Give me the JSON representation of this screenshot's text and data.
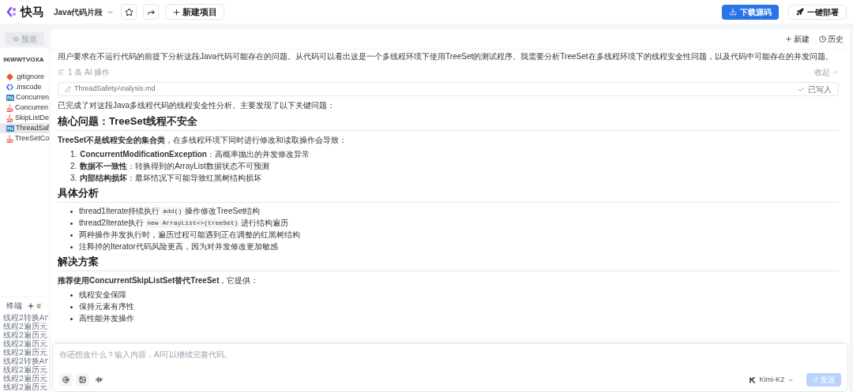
{
  "header": {
    "logo_text": "快马",
    "project_name": "Java代码片段",
    "new_project": "新建项目",
    "download": "下载源码",
    "deploy": "一键部署"
  },
  "sidebar": {
    "preview": {
      "label": "预览",
      "disabled": true
    },
    "project_id": "96WWTVOXA",
    "files": [
      {
        "name": ".gitignore",
        "kind": "git",
        "selected": false
      },
      {
        "name": ".inscode",
        "kind": "inscode",
        "selected": false
      },
      {
        "name": "Concurren",
        "kind": "markdown",
        "selected": false
      },
      {
        "name": "Concurren",
        "kind": "java",
        "selected": false
      },
      {
        "name": "SkipListDe",
        "kind": "java",
        "selected": false
      },
      {
        "name": "ThreadSaf",
        "kind": "markdown",
        "selected": true
      },
      {
        "name": "TreeSetCo",
        "kind": "java",
        "selected": false
      }
    ],
    "terminal": {
      "title": "终端",
      "lines": [
        "线程2转换Ar",
        "线程2遍历元",
        "线程2遍历元",
        "线程2遍历元",
        "线程2遍历元",
        "线程2转换Ar",
        "线程2遍历元",
        "线程2遍历元",
        "线程2遍历元"
      ]
    }
  },
  "toolbar": {
    "new": "新建",
    "history": "历史"
  },
  "blocks": [
    {
      "kind": "paragraph",
      "text": "用户要求在不运行代码的前提下分析这段Java代码可能存在的问题。从代码可以看出这是一个多线程环境下使用TreeSet的测试程序。我需要分析TreeSet在多线程环境下的线程安全性问题，以及代码中可能存在的并发问题。",
      "muted": false
    },
    {
      "kind": "ai_ops",
      "text": "1 条 AI 操作",
      "toggle": "收起",
      "expanded": true
    },
    {
      "kind": "file_card",
      "file": "ThreadSafetyAnalysis.md",
      "status": "已写入",
      "written": true
    },
    {
      "kind": "paragraph",
      "text": "已完成了对这段Java多线程代码的线程安全性分析。主要发现了以下关键问题：",
      "muted": false
    },
    {
      "kind": "heading",
      "text": "核心问题：TreeSet线程不安全"
    },
    {
      "kind": "paragraph",
      "text": "**TreeSet不是线程安全的集合类**，在多线程环境下同时进行修改和读取操作会导致：",
      "muted": false
    },
    {
      "kind": "ordered_list",
      "items": [
        {
          "number": "1.",
          "text": "**ConcurrentModificationException**：高概率抛出的并发修改异常"
        },
        {
          "number": "2.",
          "text": "**数据不一致性**：转换得到的ArrayList数据状态不可预测"
        },
        {
          "number": "3.",
          "text": "**内部结构损坏**：最坏情况下可能导致红黑树结构损坏"
        }
      ]
    },
    {
      "kind": "heading",
      "text": "具体分析"
    },
    {
      "kind": "bullet_list",
      "items": [
        {
          "parts": [
            {
              "kind": "text",
              "text": "thread1Iterate持续执行"
            },
            {
              "kind": "code",
              "text": "add()"
            },
            {
              "kind": "text",
              "text": "操作修改TreeSet结构"
            }
          ]
        },
        {
          "parts": [
            {
              "kind": "text",
              "text": "thread2Iterate执行"
            },
            {
              "kind": "code",
              "text": "new ArrayList<>(treeSet)"
            },
            {
              "kind": "text",
              "text": "进行结构遍历"
            }
          ]
        },
        {
          "parts": [
            {
              "kind": "text",
              "text": "两种操作并发执行时，遍历过程可能遇到正在调整的红黑树结构"
            }
          ]
        },
        {
          "parts": [
            {
              "kind": "text",
              "text": "注释掉的Iterator代码风险更高，因为对并发修改更加敏感"
            }
          ]
        }
      ]
    },
    {
      "kind": "heading",
      "text": "解决方案"
    },
    {
      "kind": "paragraph",
      "text": "**推荐使用ConcurrentSkipListSet替代TreeSet**，它提供：",
      "muted": false
    },
    {
      "kind": "bullet_list",
      "items": [
        {
          "parts": [
            {
              "kind": "text",
              "text": "线程安全保障"
            }
          ]
        },
        {
          "parts": [
            {
              "kind": "text",
              "text": "保持元素有序性"
            }
          ]
        },
        {
          "parts": [
            {
              "kind": "text",
              "text": "高性能并发操作"
            }
          ]
        }
      ]
    }
  ],
  "composer": {
    "placeholder": "你还想改什么？输入内容，AI可以继续完善代码。",
    "model": "Kimi-K2",
    "send": "发送",
    "send_disabled": true
  }
}
